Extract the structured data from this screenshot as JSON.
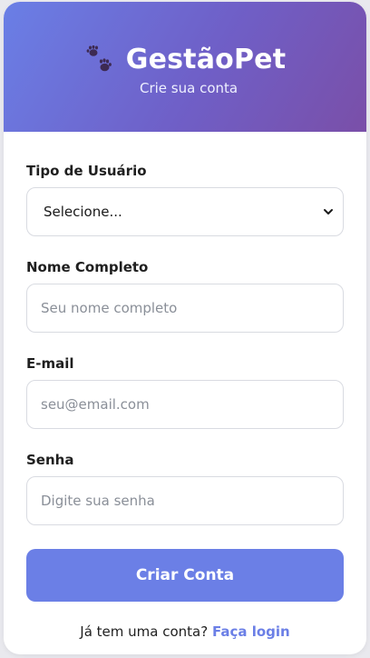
{
  "header": {
    "title": "GestãoPet",
    "subtitle": "Crie sua conta",
    "icon": "paw-icon"
  },
  "form": {
    "user_type": {
      "label": "Tipo de Usuário",
      "selected": "Selecione..."
    },
    "full_name": {
      "label": "Nome Completo",
      "placeholder": "Seu nome completo",
      "value": ""
    },
    "email": {
      "label": "E-mail",
      "placeholder": "seu@email.com",
      "value": ""
    },
    "password": {
      "label": "Senha",
      "placeholder": "Digite sua senha",
      "value": ""
    },
    "submit_label": "Criar Conta"
  },
  "footer": {
    "prompt": "Já tem uma conta?",
    "link_label": "Faça login"
  },
  "colors": {
    "accent": "#6b7fe6",
    "header_gradient_start": "#6a7fe6",
    "header_gradient_end": "#7a4fa8"
  }
}
